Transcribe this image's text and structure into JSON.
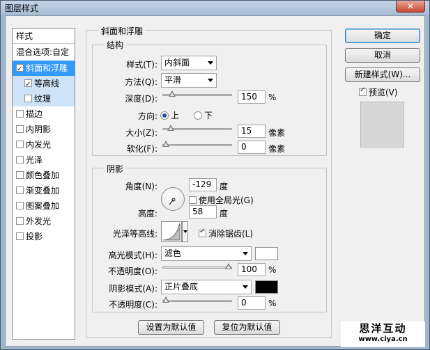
{
  "window": {
    "title": "图层样式",
    "close_glyph": "✕"
  },
  "style_list": {
    "header": "样式",
    "blend": "混合选项:自定",
    "items": [
      {
        "label": "斜面和浮雕",
        "checked": true,
        "state": "selected"
      },
      {
        "label": "等高线",
        "checked": true,
        "state": "sub"
      },
      {
        "label": "纹理",
        "checked": false,
        "state": "sub"
      },
      {
        "label": "描边",
        "checked": false
      },
      {
        "label": "内阴影",
        "checked": false
      },
      {
        "label": "内发光",
        "checked": false
      },
      {
        "label": "光泽",
        "checked": false
      },
      {
        "label": "颜色叠加",
        "checked": false
      },
      {
        "label": "渐变叠加",
        "checked": false
      },
      {
        "label": "图案叠加",
        "checked": false
      },
      {
        "label": "外发光",
        "checked": false
      },
      {
        "label": "投影",
        "checked": false
      }
    ]
  },
  "bevel": {
    "title": "斜面和浮雕",
    "structure": {
      "title": "结构",
      "style_label": "样式(T):",
      "style_value": "内斜面",
      "technique_label": "方法(Q):",
      "technique_value": "平滑",
      "depth_label": "深度(D):",
      "depth_value": "150",
      "depth_unit": "%",
      "depth_level": 0.1,
      "direction_label": "方向:",
      "direction_up": "上",
      "direction_down": "下",
      "direction_selected": "up",
      "size_label": "大小(Z):",
      "size_value": "15",
      "size_unit": "像素",
      "size_level": 0.08,
      "soften_label": "软化(F):",
      "soften_value": "0",
      "soften_unit": "像素",
      "soften_level": 0.0
    },
    "shading": {
      "title": "阴影",
      "angle_label": "角度(N):",
      "angle_value": "-129",
      "angle_unit": "度",
      "global_light_label": "使用全局光(G)",
      "global_light_checked": false,
      "altitude_label": "高度:",
      "altitude_value": "58",
      "altitude_unit": "度",
      "gloss_label": "光泽等高线:",
      "antialias_label": "消除锯齿(L)",
      "antialias_checked": true,
      "highlight_mode_label": "高光模式(H):",
      "highlight_mode_value": "滤色",
      "highlight_color": "#ffffff",
      "highlight_opacity_label": "不透明度(O):",
      "highlight_opacity_value": "100",
      "highlight_opacity_unit": "%",
      "highlight_opacity_level": 1.0,
      "shadow_mode_label": "阴影模式(A):",
      "shadow_mode_value": "正片叠底",
      "shadow_color": "#000000",
      "shadow_opacity_label": "不透明度(C):",
      "shadow_opacity_value": "0",
      "shadow_opacity_unit": "%",
      "shadow_opacity_level": 0.0
    },
    "make_default": "设置为默认值",
    "reset_default": "复位为默认值"
  },
  "buttons": {
    "ok": "确定",
    "cancel": "取消",
    "new_style": "新建样式(W)...",
    "preview_label": "预览(V)",
    "preview_checked": true
  },
  "watermark": {
    "line1": "思洋互动",
    "line2": "www.ciya.cn"
  }
}
